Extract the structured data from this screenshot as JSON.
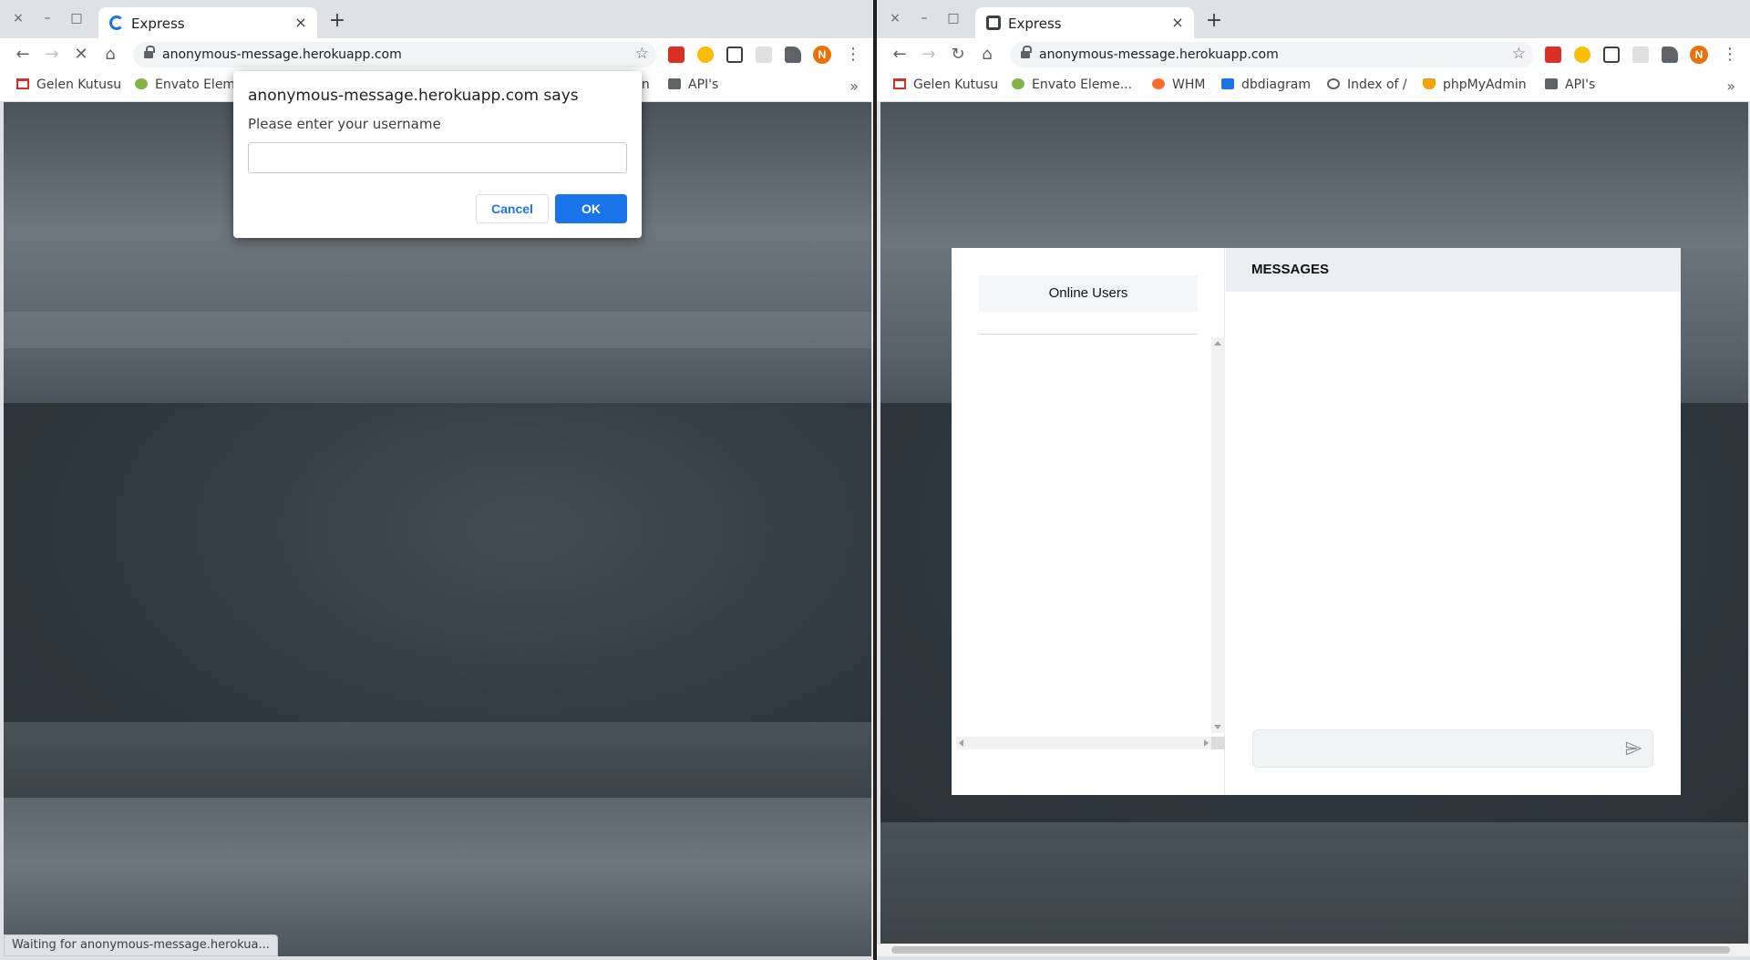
{
  "left_window": {
    "tab": {
      "title": "Express",
      "favicon": "loading-spinner-icon"
    },
    "toolbar": {
      "url": "anonymous-message.herokuapp.com",
      "reload_state": "stop-loading"
    },
    "bookmarks": [
      {
        "label": "Gelen Kutusu",
        "icon": "gmail-icon"
      },
      {
        "label": "Envato Elem",
        "icon": "leaf-icon"
      },
      {
        "label": "in",
        "icon": ""
      },
      {
        "label": "API's",
        "icon": "folder-icon"
      }
    ],
    "dialog": {
      "title": "anonymous-message.herokuapp.com says",
      "message": "Please enter your username",
      "input_value": "",
      "cancel_label": "Cancel",
      "ok_label": "OK"
    },
    "status": "Waiting for anonymous-message.herokua..."
  },
  "right_window": {
    "tab": {
      "title": "Express",
      "favicon": "app-favicon"
    },
    "toolbar": {
      "url": "anonymous-message.herokuapp.com",
      "reload_state": "reload"
    },
    "bookmarks": [
      {
        "label": "Gelen Kutusu",
        "icon": "gmail-icon"
      },
      {
        "label": "Envato Eleme...",
        "icon": "leaf-icon"
      },
      {
        "label": "WHM",
        "icon": "cpanel-icon"
      },
      {
        "label": "dbdiagram",
        "icon": "dbdiagram-icon"
      },
      {
        "label": "Index of /",
        "icon": "globe-icon"
      },
      {
        "label": "phpMyAdmin",
        "icon": "phpmyadmin-icon"
      },
      {
        "label": "API's",
        "icon": "folder-icon"
      }
    ],
    "chat": {
      "online_users_label": "Online Users",
      "messages_label": "MESSAGES",
      "message_input_value": ""
    }
  },
  "profile_initial": "N",
  "window_controls": {
    "close": "×",
    "minimize": "–",
    "maximize": "□"
  },
  "colors": {
    "accent": "#1a73e8",
    "avatar": "#e8710a",
    "chat_header": "#eceff1"
  }
}
